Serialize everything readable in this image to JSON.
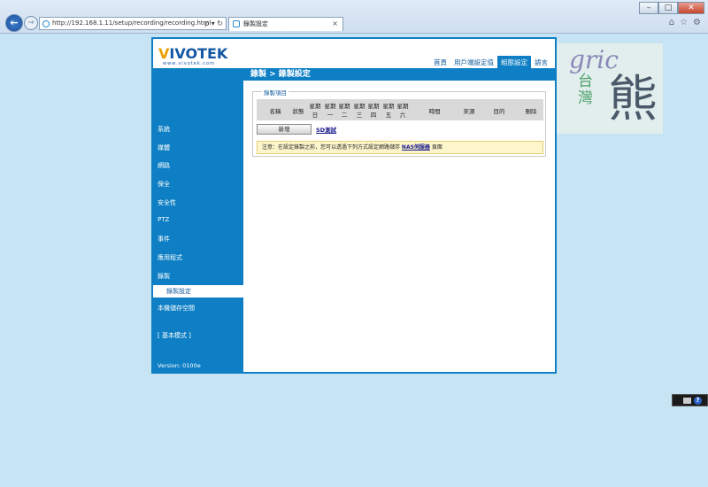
{
  "browser": {
    "url": "http://192.168.1.11/setup/recording/recording.html",
    "addr_tools": "ρ ▾ ↻",
    "tab_title": "錄製設定",
    "tab_close": "×",
    "back": "←",
    "forward": "→",
    "window_buttons": {
      "minimize": "–",
      "maximize": "□",
      "close": "✕"
    },
    "toolbar_icons": {
      "home": "⌂",
      "favorites": "☆",
      "tools": "⚙"
    }
  },
  "logo": {
    "brand_v": "V",
    "brand_rest": "IVOTEK",
    "sub": "www.vivotek.com"
  },
  "top_nav": [
    {
      "label": "首頁"
    },
    {
      "label": "用戶端設定值"
    },
    {
      "label": "組態設定",
      "active": true
    },
    {
      "label": "語言"
    }
  ],
  "page_title": "錄製  > 錄製設定",
  "sidebar": {
    "items": [
      "系統",
      "媒體",
      "網路",
      "保全",
      "安全性",
      "PTZ",
      "事件",
      "應用程式",
      "錄製"
    ],
    "subitem": "錄製設定",
    "after": "本機儲存空間",
    "mode": "[ 基本模式 ]",
    "version": "Version: 0100e"
  },
  "recording": {
    "legend": "錄製項目",
    "columns": [
      "名稱",
      "狀態",
      "星期日",
      "星期一",
      "星期二",
      "星期三",
      "星期四",
      "星期五",
      "星期六",
      "時間",
      "來源",
      "目的",
      "刪除"
    ],
    "col_top": [
      "",
      "",
      "星期",
      "星期",
      "星期",
      "星期",
      "星期",
      "星期",
      "星期",
      "",
      "",
      "",
      ""
    ],
    "col_bottom": [
      "名稱",
      "狀態",
      "日",
      "一",
      "二",
      "三",
      "四",
      "五",
      "六",
      "時間",
      "來源",
      "目的",
      "刪除"
    ],
    "add_label": "新增",
    "sd_link": "SD測試",
    "notice_before": "注意：在設定錄製之前，您可以透過下列方式設定網路儲存 ",
    "notice_link": "NAS伺服器",
    "notice_after": " 頁面"
  },
  "watermark": {
    "script": "gric",
    "left": "台灣",
    "right": "熊"
  },
  "tray": {
    "help": "?"
  }
}
